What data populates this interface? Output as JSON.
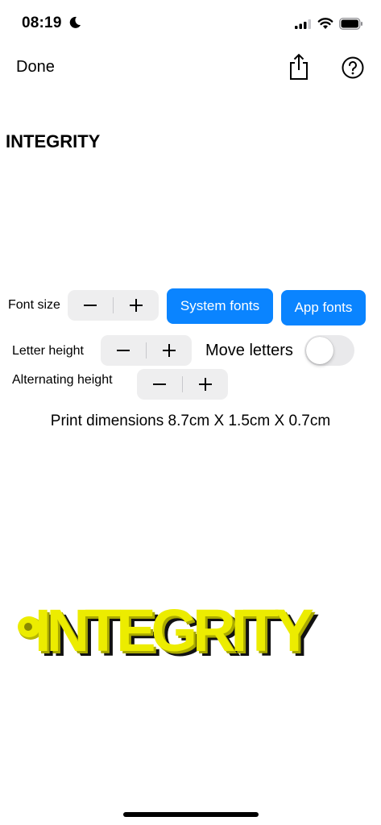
{
  "status_bar": {
    "time": "08:19"
  },
  "nav": {
    "done_label": "Done"
  },
  "preview_text": "INTEGRITY",
  "controls": {
    "font_size_label": "Font size",
    "system_fonts_label": "System fonts",
    "app_fonts_label": "App fonts",
    "letter_height_label": "Letter height",
    "move_letters_label": "Move letters",
    "move_letters_on": false,
    "alternating_height_label": "Alternating height",
    "minus": "−",
    "plus": "+"
  },
  "print_dimensions": "Print dimensions 8.7cm X 1.5cm X 0.7cm",
  "model_text": "INTEGRITY",
  "colors": {
    "accent": "#0a84ff",
    "model_yellow": "#ecec00",
    "stepper_bg": "#eeeeef"
  }
}
